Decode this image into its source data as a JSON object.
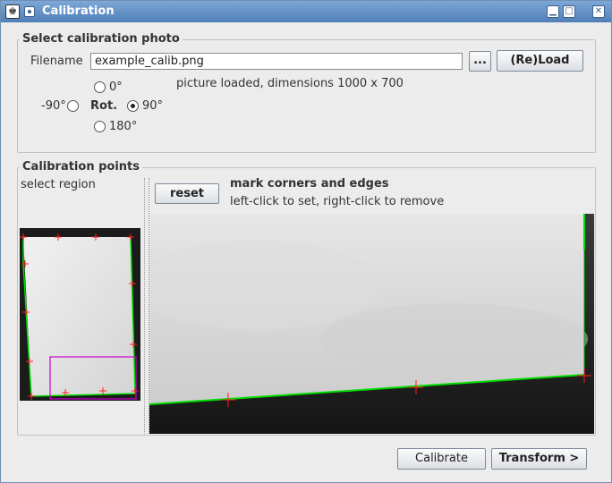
{
  "window": {
    "title": "Calibration",
    "app_icon_glyph": "♚",
    "controls": {
      "minimize": "▁",
      "maximize": "□",
      "close": "✕"
    }
  },
  "photo_group": {
    "title": "Select calibration photo",
    "filename_label": "Filename",
    "filename_value": "example_calib.png",
    "browse_label": "...",
    "reload_label": "(Re)Load",
    "status_text": "picture loaded, dimensions 1000 x 700",
    "rotation": {
      "label": "Rot.",
      "opt_0": "0°",
      "opt_neg90": "-90°",
      "opt_90": "90°",
      "opt_180": "180°",
      "selected": "90°"
    }
  },
  "points_group": {
    "title": "Calibration points",
    "select_region_label": "select region",
    "reset_label": "reset",
    "heading": "mark corners and edges",
    "hint": "left-click to set, right-click to remove"
  },
  "footer": {
    "calibrate_label": "Calibrate",
    "transform_label": "Transform >"
  },
  "colors": {
    "edge_line": "#00dd00",
    "marker": "#ff2020",
    "region": "#cc00cc",
    "titlebar": "#5a88c0"
  },
  "icons": [
    "app-icon",
    "window-menu-icon",
    "minimize-icon",
    "maximize-icon",
    "close-icon",
    "crosshair-marker-icon"
  ]
}
